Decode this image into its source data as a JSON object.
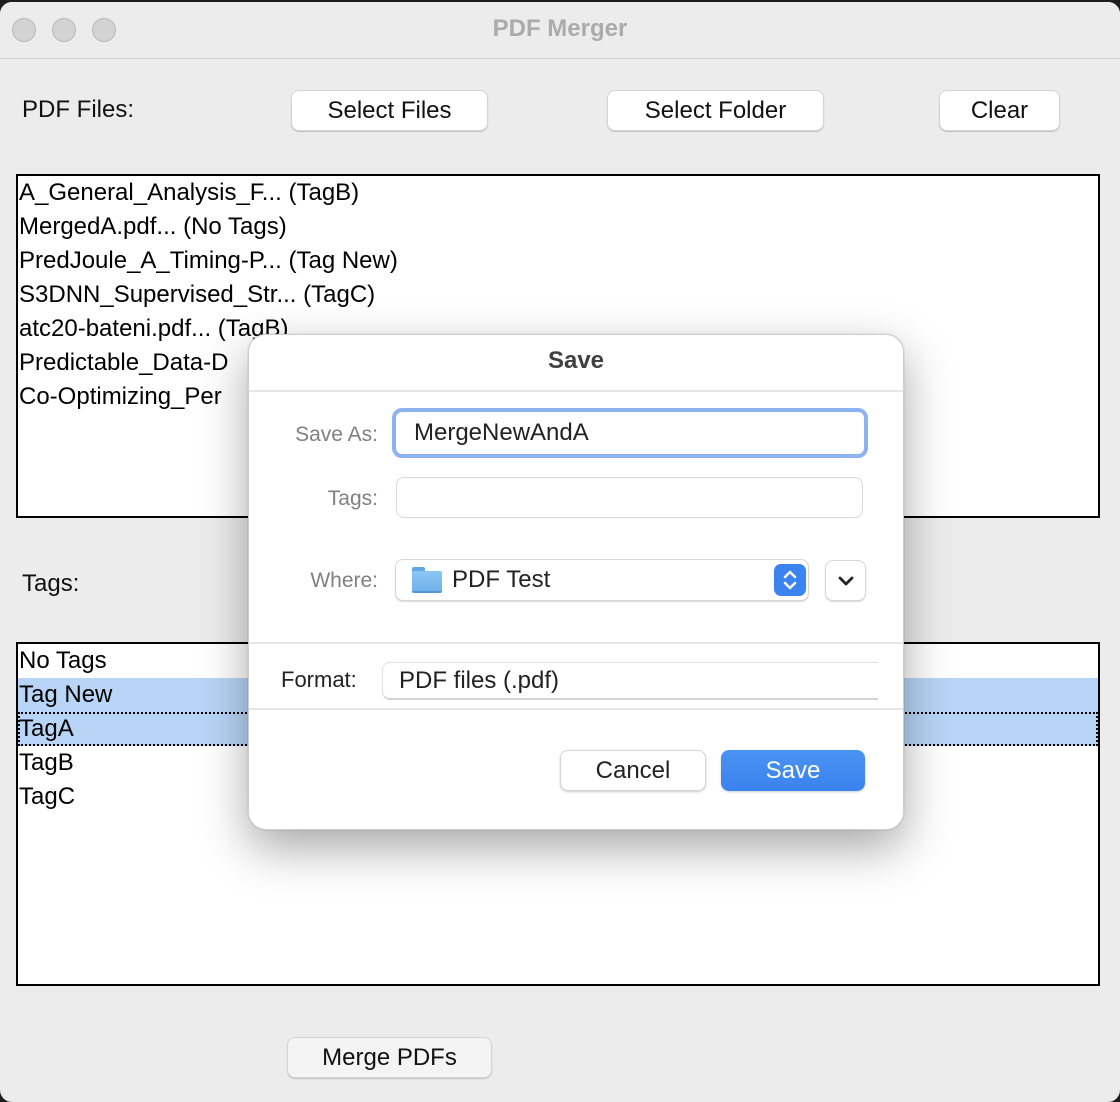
{
  "window": {
    "title": "PDF Merger",
    "traffic_lights": [
      "close",
      "minimize",
      "zoom"
    ]
  },
  "files_section": {
    "label": "PDF Files:",
    "select_files_label": "Select Files",
    "select_folder_label": "Select Folder",
    "clear_label": "Clear",
    "files": [
      "A_General_Analysis_F... (TagB)",
      "MergedA.pdf... (No Tags)",
      "PredJoule_A_Timing-P... (Tag New)",
      "S3DNN_Supervised_Str... (TagC)",
      "atc20-bateni.pdf... (TagB)",
      "Predictable_Data-D",
      "Co-Optimizing_Per"
    ]
  },
  "tags_section": {
    "label": "Tags:",
    "tags": [
      {
        "label": "No Tags",
        "selected": false,
        "focused": false
      },
      {
        "label": "Tag New",
        "selected": true,
        "focused": false
      },
      {
        "label": "TagA",
        "selected": true,
        "focused": true
      },
      {
        "label": "TagB",
        "selected": false,
        "focused": false
      },
      {
        "label": "TagC",
        "selected": false,
        "focused": false
      }
    ],
    "selection_color": "#b8d5f7"
  },
  "merge_button_label": "Merge PDFs",
  "save_dialog": {
    "title": "Save",
    "save_as_label": "Save As:",
    "save_as_value": "MergeNewAndA",
    "tags_label": "Tags:",
    "tags_value": "",
    "where_label": "Where:",
    "where_value": "PDF Test",
    "format_label": "Format:",
    "format_value": "PDF files (.pdf)",
    "cancel_label": "Cancel",
    "save_label": "Save",
    "accent_color": "#3b84f0",
    "focus_ring_color": "#8db2f0"
  }
}
